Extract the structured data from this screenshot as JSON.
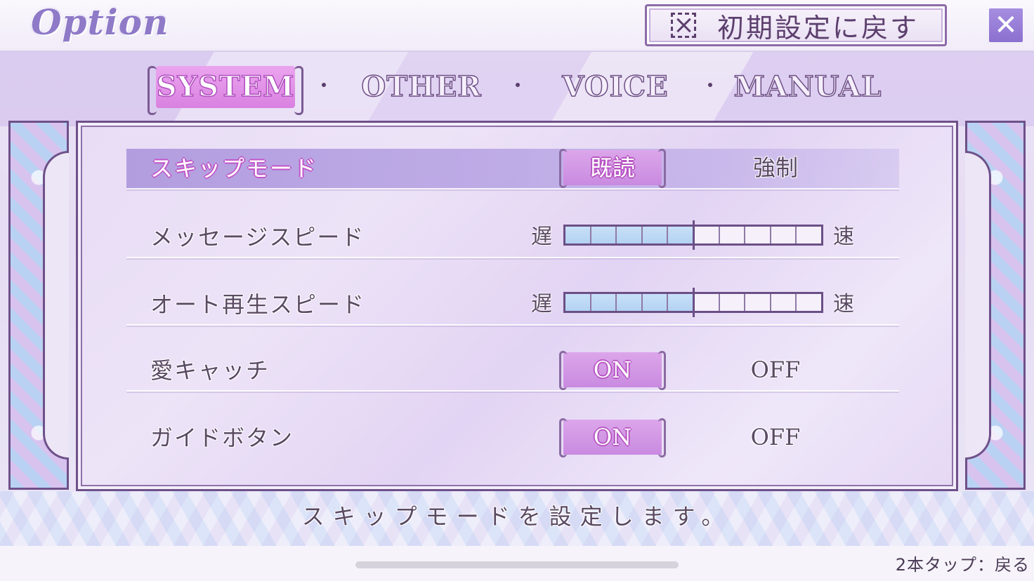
{
  "header": {
    "title": "Option",
    "reset_button_label": "初期設定に戻す",
    "reset_icon": "reset-box-icon",
    "close_icon": "close-icon",
    "close_glyph": "✕"
  },
  "tabs": [
    {
      "label": "SYSTEM",
      "active": true
    },
    {
      "label": "OTHER",
      "active": false
    },
    {
      "label": "VOICE",
      "active": false
    },
    {
      "label": "MANUAL",
      "active": false
    }
  ],
  "settings": {
    "skip_mode": {
      "label": "スキップモード",
      "options": [
        "既読",
        "強制"
      ],
      "selected": "既読"
    },
    "message_speed": {
      "label": "メッセージスピード",
      "slow_label": "遅",
      "fast_label": "速",
      "segments": 10,
      "level": 5
    },
    "auto_speed": {
      "label": "オート再生スピード",
      "slow_label": "遅",
      "fast_label": "速",
      "segments": 10,
      "level": 5
    },
    "love_catch": {
      "label": "愛キャッチ",
      "options": [
        "ON",
        "OFF"
      ],
      "selected": "ON"
    },
    "guide_button": {
      "label": "ガイドボタン",
      "options": [
        "ON",
        "OFF"
      ],
      "selected": "ON"
    }
  },
  "description": "スキップモードを設定します。",
  "footer": {
    "back_hint": "2本タップ：戻る"
  },
  "colors": {
    "accent": "#d981e0",
    "frame": "#6e5089",
    "text": "#5a4a63",
    "slider_fill": "#b3d2f2"
  }
}
